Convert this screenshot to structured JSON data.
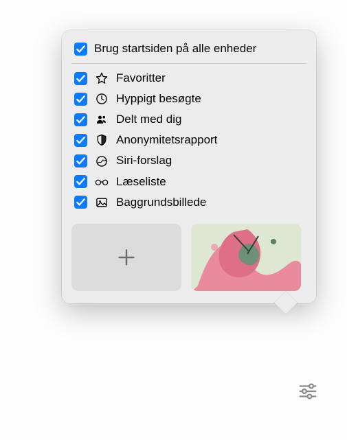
{
  "header": {
    "label": "Brug startsiden på alle enheder"
  },
  "options": [
    {
      "key": "favorites",
      "icon": "star-icon",
      "label": "Favoritter"
    },
    {
      "key": "frequent",
      "icon": "clock-icon",
      "label": "Hyppigt besøgte"
    },
    {
      "key": "shared",
      "icon": "shared-with-you-icon",
      "label": "Delt med dig"
    },
    {
      "key": "privacy",
      "icon": "shield-icon",
      "label": "Anonymitetsrapport"
    },
    {
      "key": "siri",
      "icon": "siri-icon",
      "label": "Siri-forslag"
    },
    {
      "key": "readinglist",
      "icon": "glasses-icon",
      "label": "Læseliste"
    },
    {
      "key": "background",
      "icon": "image-icon",
      "label": "Baggrundsbillede"
    }
  ],
  "colors": {
    "accent": "#0a7aff"
  }
}
